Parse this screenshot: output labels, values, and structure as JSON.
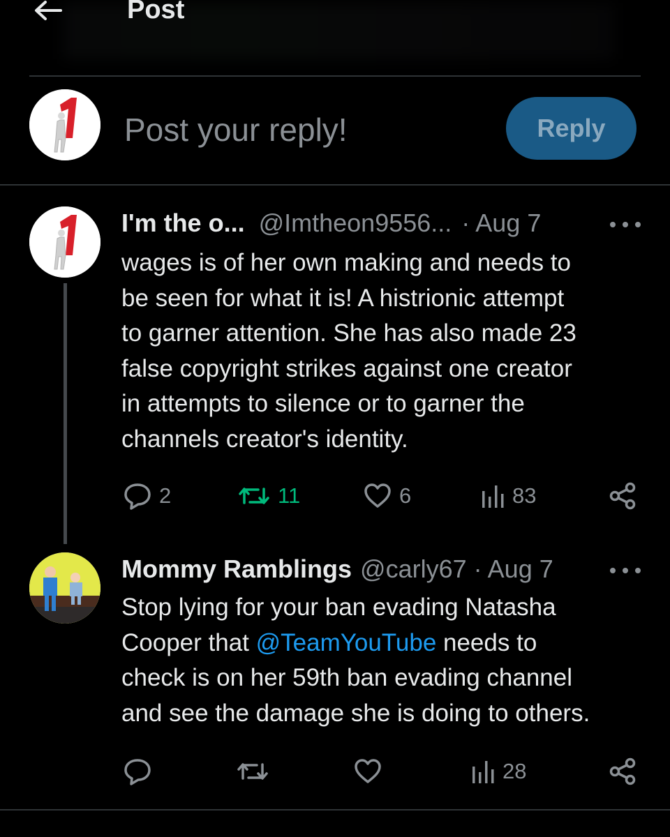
{
  "header": {
    "title": "Post"
  },
  "composer": {
    "placeholder": "Post your reply!",
    "reply_label": "Reply"
  },
  "tweets": [
    {
      "name": "I'm the o...",
      "handle": "@Imtheon9556...",
      "separator": "·",
      "date": "Aug 7",
      "text": "wages is of her own making and needs to\nbe seen for what it is!  A histrionic attempt\nto garner attention.  She has also made 23\nfalse copyright strikes against one creator\nin attempts to silence or to garner the\nchannels creator's identity.",
      "replies": "2",
      "reposts": "11",
      "likes": "6",
      "views": "83"
    },
    {
      "name": "Mommy Ramblings",
      "handle": "@carly67",
      "separator": "·",
      "date": "Aug 7",
      "text_before": "Stop lying for your ban evading Natasha\nCooper that ",
      "mention": "@TeamYouTube",
      "text_after": " needs to\ncheck is on her 59th ban evading channel\nand see the damage she is doing to others.",
      "replies": "",
      "reposts": "",
      "likes": "",
      "views": "28"
    }
  ],
  "colors": {
    "background": "#000000",
    "text": "#e7e9ea",
    "muted": "#8b9095",
    "accent": "#1d9bf0",
    "repost_active": "#00ba7c",
    "reply_button": "#1a5a86"
  },
  "icons": {
    "back": "arrow-left-icon",
    "reply": "speech-bubble-icon",
    "repost": "repost-icon",
    "like": "heart-icon",
    "views": "bar-chart-icon",
    "share": "share-icon",
    "more": "more-dots-icon"
  }
}
